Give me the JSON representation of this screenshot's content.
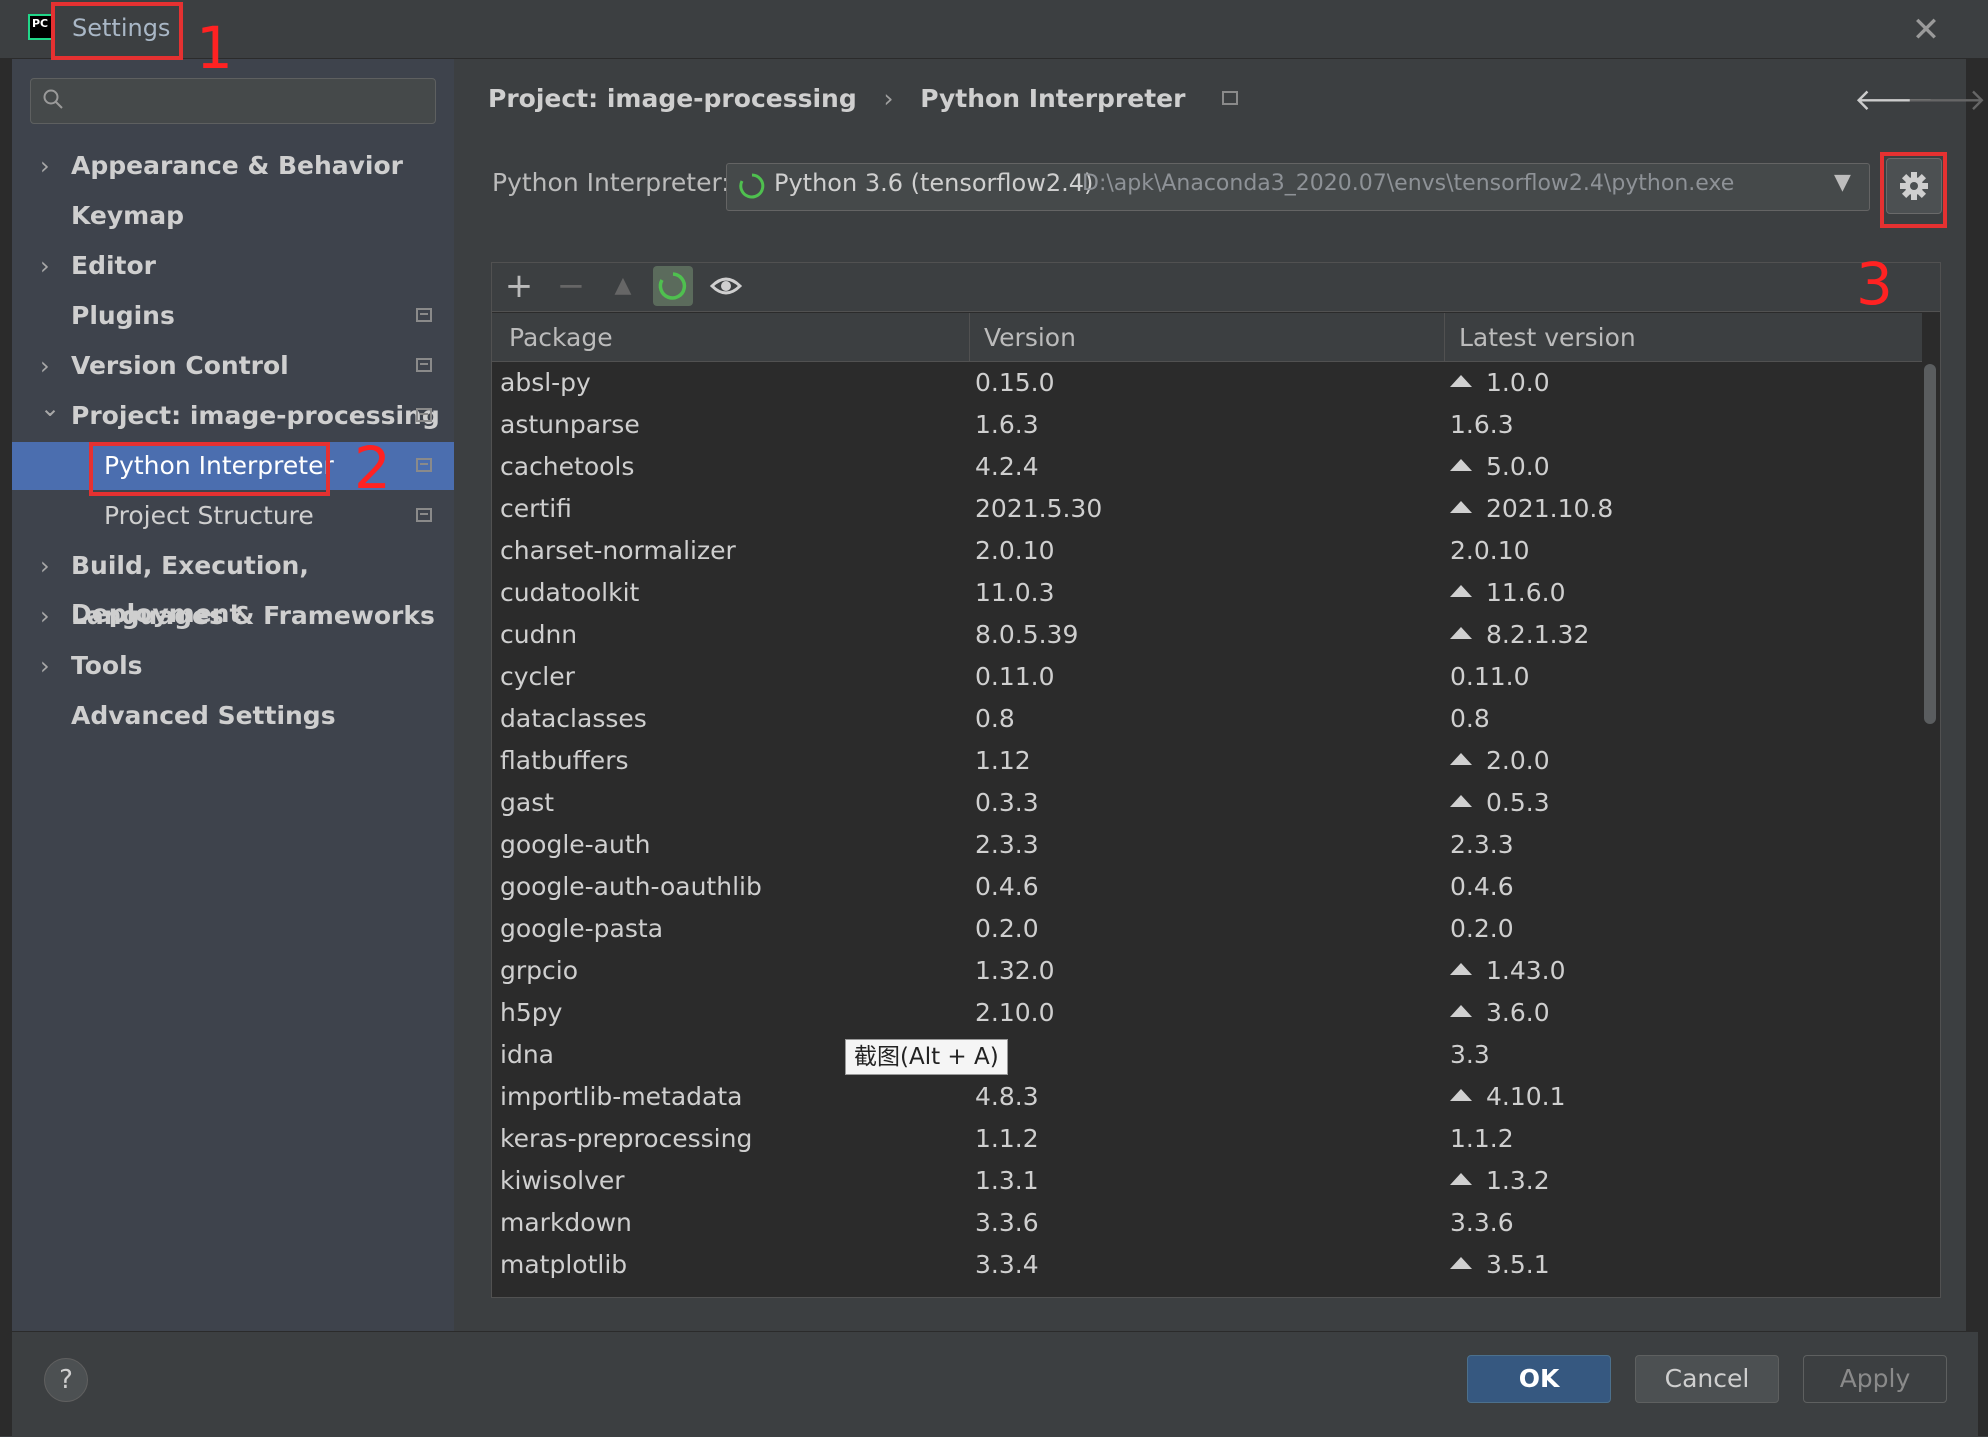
{
  "window": {
    "title": "Settings",
    "close_symbol": "✕"
  },
  "search": {
    "placeholder": "",
    "icon": "search-icon"
  },
  "sidebar": {
    "items": [
      {
        "label": "Appearance & Behavior",
        "expandable": true,
        "expanded": false,
        "bold": true,
        "project_icon": false
      },
      {
        "label": "Keymap",
        "expandable": false,
        "bold": true,
        "project_icon": false
      },
      {
        "label": "Editor",
        "expandable": true,
        "expanded": false,
        "bold": true,
        "project_icon": false
      },
      {
        "label": "Plugins",
        "expandable": false,
        "bold": true,
        "project_icon": true
      },
      {
        "label": "Version Control",
        "expandable": true,
        "expanded": false,
        "bold": true,
        "project_icon": true
      },
      {
        "label": "Project: image-processing",
        "expandable": true,
        "expanded": true,
        "bold": true,
        "project_icon": true
      },
      {
        "label": "Python Interpreter",
        "expandable": false,
        "bold": false,
        "project_icon": true,
        "selected": true,
        "child": true
      },
      {
        "label": "Project Structure",
        "expandable": false,
        "bold": false,
        "project_icon": true,
        "child": true
      },
      {
        "label": "Build, Execution, Deployment",
        "expandable": true,
        "expanded": false,
        "bold": true,
        "project_icon": false
      },
      {
        "label": "Languages & Frameworks",
        "expandable": true,
        "expanded": false,
        "bold": true,
        "project_icon": false
      },
      {
        "label": "Tools",
        "expandable": true,
        "expanded": false,
        "bold": true,
        "project_icon": false
      },
      {
        "label": "Advanced Settings",
        "expandable": false,
        "bold": true,
        "project_icon": false
      }
    ]
  },
  "breadcrumb": {
    "project": "Project: image-processing",
    "separator": "›",
    "page": "Python Interpreter"
  },
  "interpreter": {
    "label": "Python Interpreter:",
    "name": "Python 3.6 (tensorflow2.4)",
    "path": "D:\\apk\\Anaconda3_2020.07\\envs\\tensorflow2.4\\python.exe"
  },
  "toolbar": {
    "add": "+",
    "remove": "−",
    "upgrade": "▲"
  },
  "table": {
    "columns": [
      "Package",
      "Version",
      "Latest version"
    ],
    "rows": [
      {
        "package": "absl-py",
        "version": "0.15.0",
        "latest": "1.0.0",
        "upgrade": true
      },
      {
        "package": "astunparse",
        "version": "1.6.3",
        "latest": "1.6.3",
        "upgrade": false
      },
      {
        "package": "cachetools",
        "version": "4.2.4",
        "latest": "5.0.0",
        "upgrade": true
      },
      {
        "package": "certifi",
        "version": "2021.5.30",
        "latest": "2021.10.8",
        "upgrade": true
      },
      {
        "package": "charset-normalizer",
        "version": "2.0.10",
        "latest": "2.0.10",
        "upgrade": false
      },
      {
        "package": "cudatoolkit",
        "version": "11.0.3",
        "latest": "11.6.0",
        "upgrade": true
      },
      {
        "package": "cudnn",
        "version": "8.0.5.39",
        "latest": "8.2.1.32",
        "upgrade": true
      },
      {
        "package": "cycler",
        "version": "0.11.0",
        "latest": "0.11.0",
        "upgrade": false
      },
      {
        "package": "dataclasses",
        "version": "0.8",
        "latest": "0.8",
        "upgrade": false
      },
      {
        "package": "flatbuffers",
        "version": "1.12",
        "latest": "2.0.0",
        "upgrade": true
      },
      {
        "package": "gast",
        "version": "0.3.3",
        "latest": "0.5.3",
        "upgrade": true
      },
      {
        "package": "google-auth",
        "version": "2.3.3",
        "latest": "2.3.3",
        "upgrade": false
      },
      {
        "package": "google-auth-oauthlib",
        "version": "0.4.6",
        "latest": "0.4.6",
        "upgrade": false
      },
      {
        "package": "google-pasta",
        "version": "0.2.0",
        "latest": "0.2.0",
        "upgrade": false
      },
      {
        "package": "grpcio",
        "version": "1.32.0",
        "latest": "1.43.0",
        "upgrade": true
      },
      {
        "package": "h5py",
        "version": "2.10.0",
        "latest": "3.6.0",
        "upgrade": true
      },
      {
        "package": "idna",
        "version": "",
        "latest": "3.3",
        "upgrade": false
      },
      {
        "package": "importlib-metadata",
        "version": "4.8.3",
        "latest": "4.10.1",
        "upgrade": true
      },
      {
        "package": "keras-preprocessing",
        "version": "1.1.2",
        "latest": "1.1.2",
        "upgrade": false
      },
      {
        "package": "kiwisolver",
        "version": "1.3.1",
        "latest": "1.3.2",
        "upgrade": true
      },
      {
        "package": "markdown",
        "version": "3.3.6",
        "latest": "3.3.6",
        "upgrade": false
      },
      {
        "package": "matplotlib",
        "version": "3.3.4",
        "latest": "3.5.1",
        "upgrade": true
      }
    ]
  },
  "tooltip": {
    "text": "截图(Alt + A)"
  },
  "footer": {
    "help": "?",
    "ok": "OK",
    "cancel": "Cancel",
    "apply": "Apply"
  },
  "annotations": {
    "n1": "1",
    "n2": "2",
    "n3": "3"
  },
  "colors": {
    "selection": "#4b6eaf",
    "annotation": "#e53131",
    "ok_button": "#365880"
  }
}
